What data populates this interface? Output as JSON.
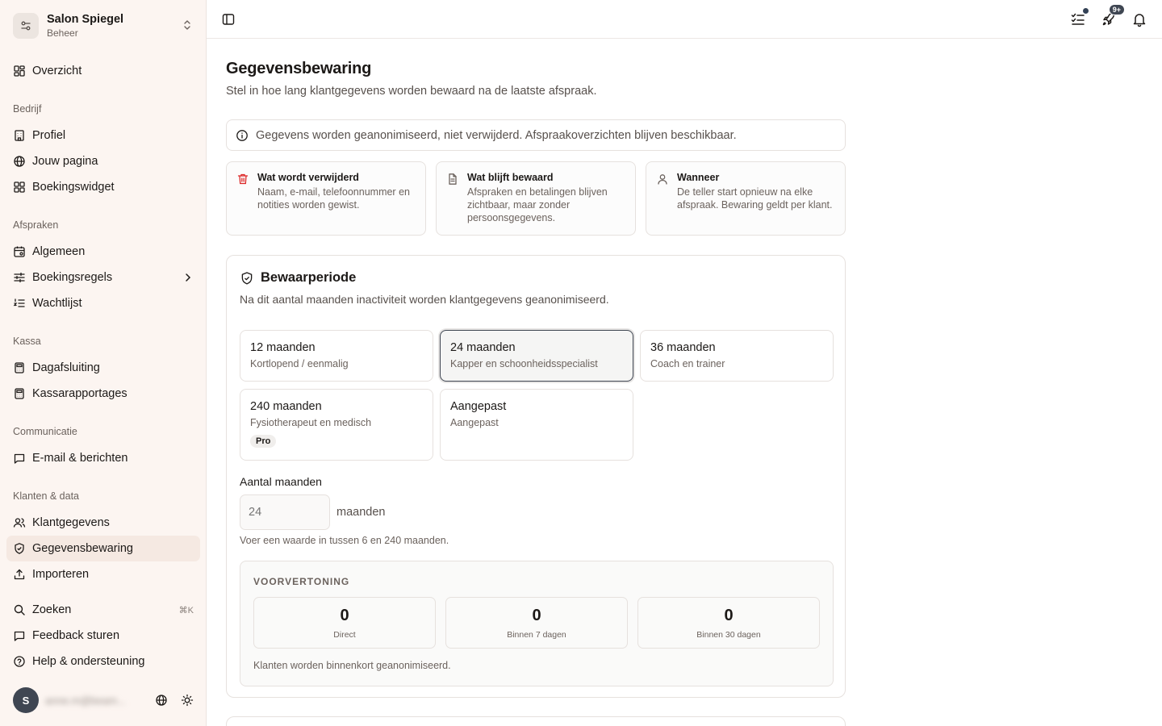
{
  "workspace": {
    "name": "Salon Spiegel",
    "subtitle": "Beheer"
  },
  "sidebar": {
    "overview": "Overzicht",
    "groups": {
      "company": "Bedrijf",
      "appointments": "Afspraken",
      "register": "Kassa",
      "communication": "Communicatie",
      "customers": "Klanten & data"
    },
    "items": {
      "profile": "Profiel",
      "your_page": "Jouw pagina",
      "booking_widget": "Boekingswidget",
      "general": "Algemeen",
      "booking_rules": "Boekingsregels",
      "waitlist": "Wachtlijst",
      "day_close": "Dagafsluiting",
      "register_reports": "Kassarapportages",
      "email_messages": "E-mail & berichten",
      "customer_data": "Klantgegevens",
      "data_retention": "Gegevensbewaring",
      "import": "Importeren",
      "search": "Zoeken",
      "search_shortcut": "⌘K",
      "feedback": "Feedback sturen",
      "help": "Help & ondersteuning"
    },
    "user": {
      "initial": "S",
      "email": "anne.m@beam..."
    }
  },
  "topbar": {
    "notification_badge": "9+"
  },
  "page": {
    "title": "Gegevensbewaring",
    "description": "Stel in hoe lang klantgegevens worden bewaard na de laatste afspraak.",
    "info": "Gegevens worden geanonimiseerd, niet verwijderd. Afspraakoverzichten blijven beschikbaar.",
    "cards": [
      {
        "title": "Wat wordt verwijderd",
        "text": "Naam, e-mail, telefoonnummer en notities worden gewist."
      },
      {
        "title": "Wat blijft bewaard",
        "text": "Afspraken en betalingen blijven zichtbaar, maar zonder persoonsgegevens."
      },
      {
        "title": "Wanneer",
        "text": "De teller start opnieuw na elke afspraak. Bewaring geldt per klant."
      }
    ]
  },
  "retention": {
    "title": "Bewaarperiode",
    "description": "Na dit aantal maanden inactiviteit worden klantgegevens geanonimiseerd.",
    "options": [
      {
        "title": "12 maanden",
        "sub": "Kortlopend / eenmalig"
      },
      {
        "title": "24 maanden",
        "sub": "Kapper en schoonheidsspecialist"
      },
      {
        "title": "36 maanden",
        "sub": "Coach en trainer"
      },
      {
        "title": "240 maanden",
        "sub": "Fysiotherapeut en medisch",
        "badge": "Pro"
      },
      {
        "title": "Aangepast",
        "sub": "Aangepast"
      }
    ],
    "selected_option": "24 maanden",
    "months_label": "Aantal maanden",
    "months_placeholder": "24",
    "months_unit": "maanden",
    "months_help": "Voer een waarde in tussen 6 en 240 maanden."
  },
  "preview": {
    "label": "VOORVERTONING",
    "stats": [
      {
        "value": "0",
        "label": "Direct"
      },
      {
        "value": "0",
        "label": "Binnen 7 dagen"
      },
      {
        "value": "0",
        "label": "Binnen 30 dagen"
      }
    ],
    "note": "Klanten worden binnenkort geanonimiseerd."
  }
}
